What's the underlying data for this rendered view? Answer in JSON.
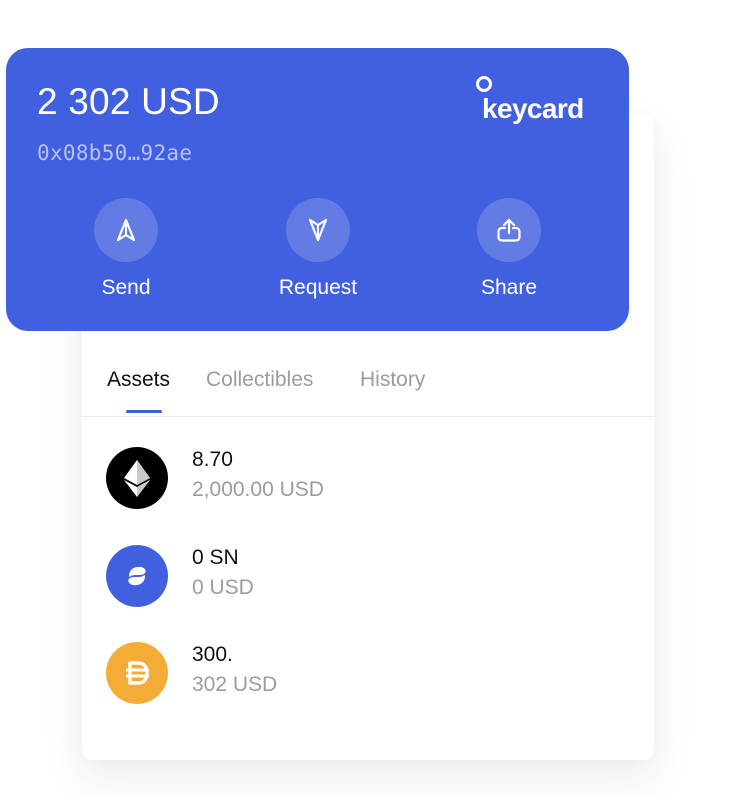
{
  "wallet": {
    "balance": "2 302 USD",
    "address": "0x08b50…92ae",
    "logo_text": "keycard",
    "actions": [
      {
        "label": "Send",
        "icon": "send-icon"
      },
      {
        "label": "Request",
        "icon": "request-icon"
      },
      {
        "label": "Share",
        "icon": "share-icon"
      }
    ]
  },
  "tabs": [
    {
      "label": "Assets",
      "active": true
    },
    {
      "label": "Collectibles",
      "active": false
    },
    {
      "label": "History",
      "active": false
    }
  ],
  "assets": [
    {
      "amount": "8.70",
      "fiat": "2,000.00 USD",
      "icon": "ethereum-icon"
    },
    {
      "amount": "0 SN",
      "fiat": "0 USD",
      "icon": "status-icon"
    },
    {
      "amount": "300.",
      "fiat": "302 USD",
      "icon": "dai-icon"
    }
  ],
  "colors": {
    "brand_blue": "#4160df",
    "muted_text": "#9b9ba3",
    "dai_orange": "#f5ac37"
  }
}
